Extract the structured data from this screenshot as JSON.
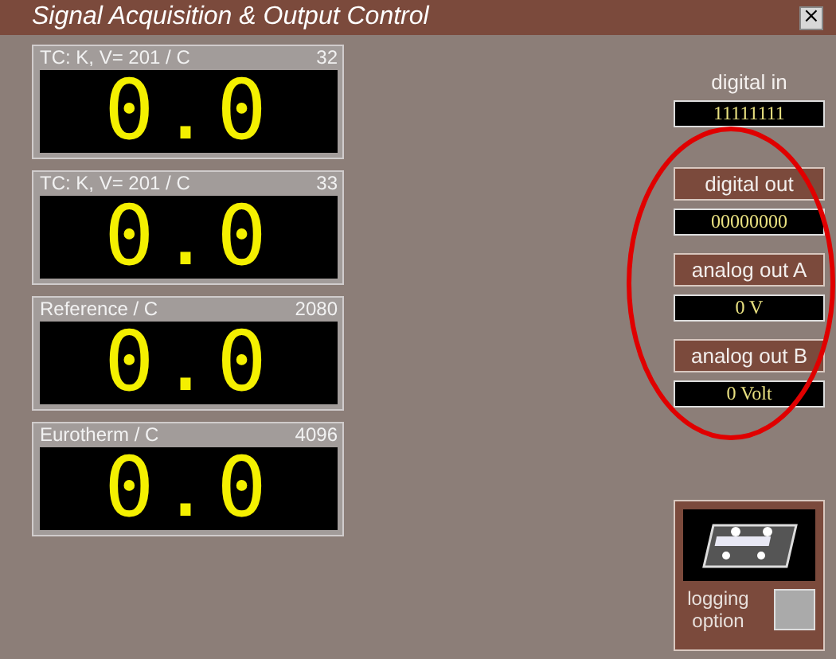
{
  "window": {
    "title": "Signal Acquisition & Output Control",
    "close": "×"
  },
  "displays": [
    {
      "label": "TC: K, V= 201 / C",
      "code": "32",
      "value": "0.0"
    },
    {
      "label": "TC: K, V= 201 / C",
      "code": "33",
      "value": "0.0"
    },
    {
      "label": "Reference / C",
      "code": "2080",
      "value": "0.0"
    },
    {
      "label": "Eurotherm / C",
      "code": "4096",
      "value": "0.0"
    }
  ],
  "io": [
    {
      "kind": "label",
      "label": "digital in",
      "value": "11111111"
    },
    {
      "kind": "button",
      "label": "digital out",
      "value": "00000000"
    },
    {
      "kind": "button",
      "label": "analog out A",
      "value": "0 V"
    },
    {
      "kind": "button",
      "label": "analog out B",
      "value": "0 Volt"
    }
  ],
  "logging": {
    "label": "logging option",
    "checked": false
  }
}
